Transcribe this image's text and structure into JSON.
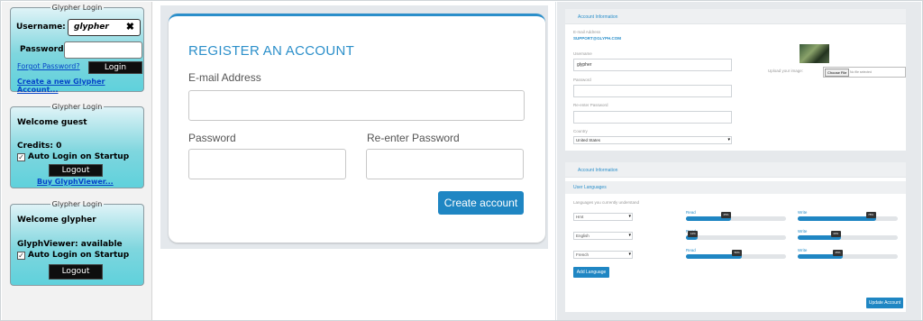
{
  "login_panels": {
    "panel1": {
      "legend": "Glypher Login",
      "username_label": "Username:",
      "username_value": "glypher",
      "password_label": "Password:",
      "forgot_label": "Forgot Password?",
      "login_label": "Login",
      "create_label": "Create a new Glypher Account..."
    },
    "panel2": {
      "legend": "Glypher Login",
      "welcome": "Welcome guest",
      "credits": "Credits: 0",
      "auto_login": "Auto Login on Startup",
      "logout_label": "Logout",
      "buy_label": "Buy GlyphViewer..."
    },
    "panel3": {
      "legend": "Glypher Login",
      "welcome": "Welcome glypher",
      "availability": "GlyphViewer: available",
      "auto_login": "Auto Login on Startup",
      "logout_label": "Logout"
    }
  },
  "register": {
    "title": "REGISTER AN ACCOUNT",
    "email_label": "E-mail Address",
    "password_label": "Password",
    "reenter_label": "Re-enter Password",
    "submit_label": "Create account"
  },
  "account_info": {
    "header": "Account Information",
    "email_label": "E-mail Address",
    "email_value": "SUPPORT@GLYPH.COM",
    "username_label": "Username",
    "username_value": "glypher",
    "password_label": "Password",
    "reenter_label": "Re-enter Password",
    "country_label": "Country",
    "country_value": "United States",
    "upload_label": "Upload your image:",
    "choose_file_label": "Choose File",
    "no_file_label": "No file selected"
  },
  "languages": {
    "header": "Account Information",
    "section_title": "User Languages",
    "subtitle": "Languages you currently understand",
    "read_label": "Read",
    "write_label": "Write",
    "rows": [
      {
        "language": "Hmt",
        "read": 0.45,
        "read_text": "45%",
        "write": 0.78,
        "write_text": "78%"
      },
      {
        "language": "English",
        "read": 0.12,
        "read_text": "12%",
        "write": 0.43,
        "write_text": "43%"
      },
      {
        "language": "French",
        "read": 0.56,
        "read_text": "56%",
        "write": 0.45,
        "write_text": "45%"
      }
    ],
    "add_label": "Add Language",
    "update_label": "Update Account"
  },
  "colors": {
    "accent": "#1f86c3",
    "panel_cyan": "#5fd1dc"
  },
  "icons": {
    "clear": "close-x-icon",
    "check": "checkmark-icon",
    "dropdown": "chevron-down-icon"
  }
}
